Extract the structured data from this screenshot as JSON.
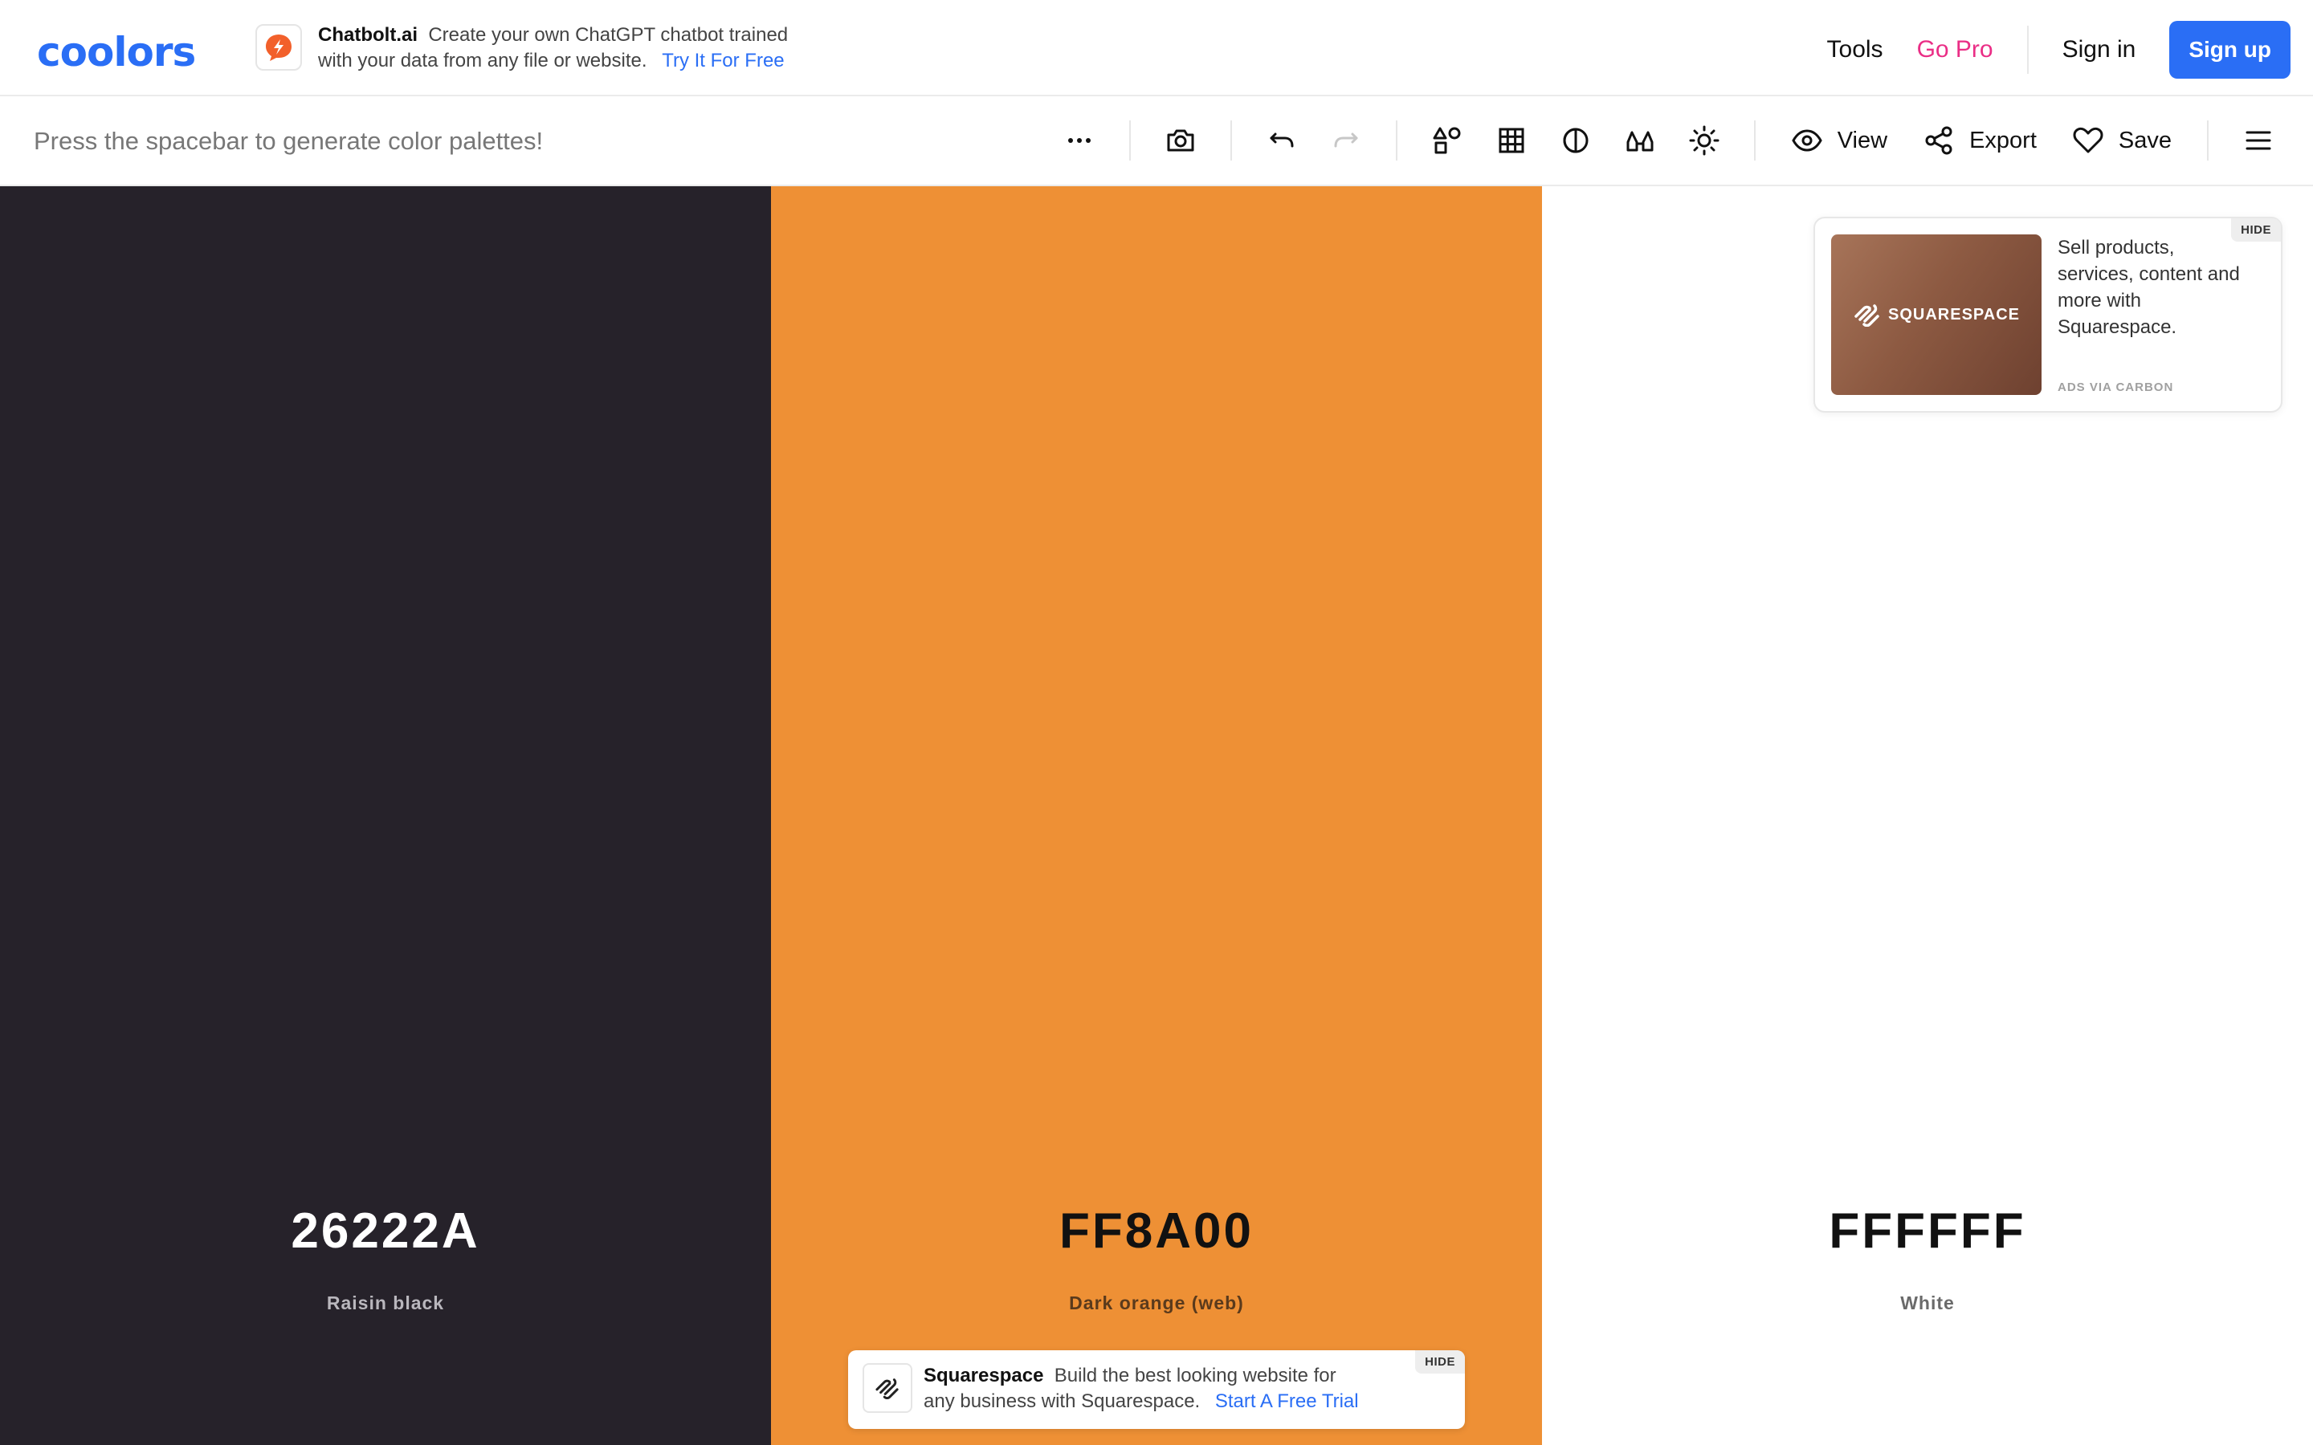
{
  "header": {
    "logo": "coolors",
    "promo": {
      "brand": "Chatbolt.ai",
      "text_line1": "Create your own ChatGPT chatbot trained",
      "text_line2": "with your data from any file or website.",
      "link": "Try It For Free",
      "icon": "chatbolt-logo-icon"
    },
    "nav": {
      "tools": "Tools",
      "go_pro": "Go Pro",
      "sign_in": "Sign in",
      "sign_up": "Sign up"
    }
  },
  "toolbar": {
    "hint": "Press the spacebar to generate color palettes!",
    "icons": [
      "more-options-icon",
      "camera-icon",
      "undo-icon",
      "redo-icon",
      "shapes-icon",
      "grid-icon",
      "contrast-icon",
      "glasses-icon",
      "sun-icon"
    ],
    "view": "View",
    "export": "Export",
    "save": "Save",
    "menu_icon": "hamburger-menu-icon"
  },
  "palette": {
    "swatches": [
      {
        "hex": "26222A",
        "name": "Raisin black",
        "color": "#26222A"
      },
      {
        "hex": "FF8A00",
        "name": "Dark orange (web)",
        "color": "#EE9035"
      },
      {
        "hex": "FFFFFF",
        "name": "White",
        "color": "#FFFFFF"
      }
    ]
  },
  "carbon_ad": {
    "image_text": "SQUARESPACE",
    "text": "Sell products, services, content and more with Squarespace.",
    "via": "ADS VIA CARBON",
    "hide": "HIDE"
  },
  "bottom_ad": {
    "brand": "Squarespace",
    "text_line1": "Build the best looking website for",
    "text_line2": "any business with Squarespace.",
    "link": "Start A Free Trial",
    "hide": "HIDE"
  },
  "colors": {
    "accent": "#2A6EF5",
    "pro": "#EA2E86"
  }
}
